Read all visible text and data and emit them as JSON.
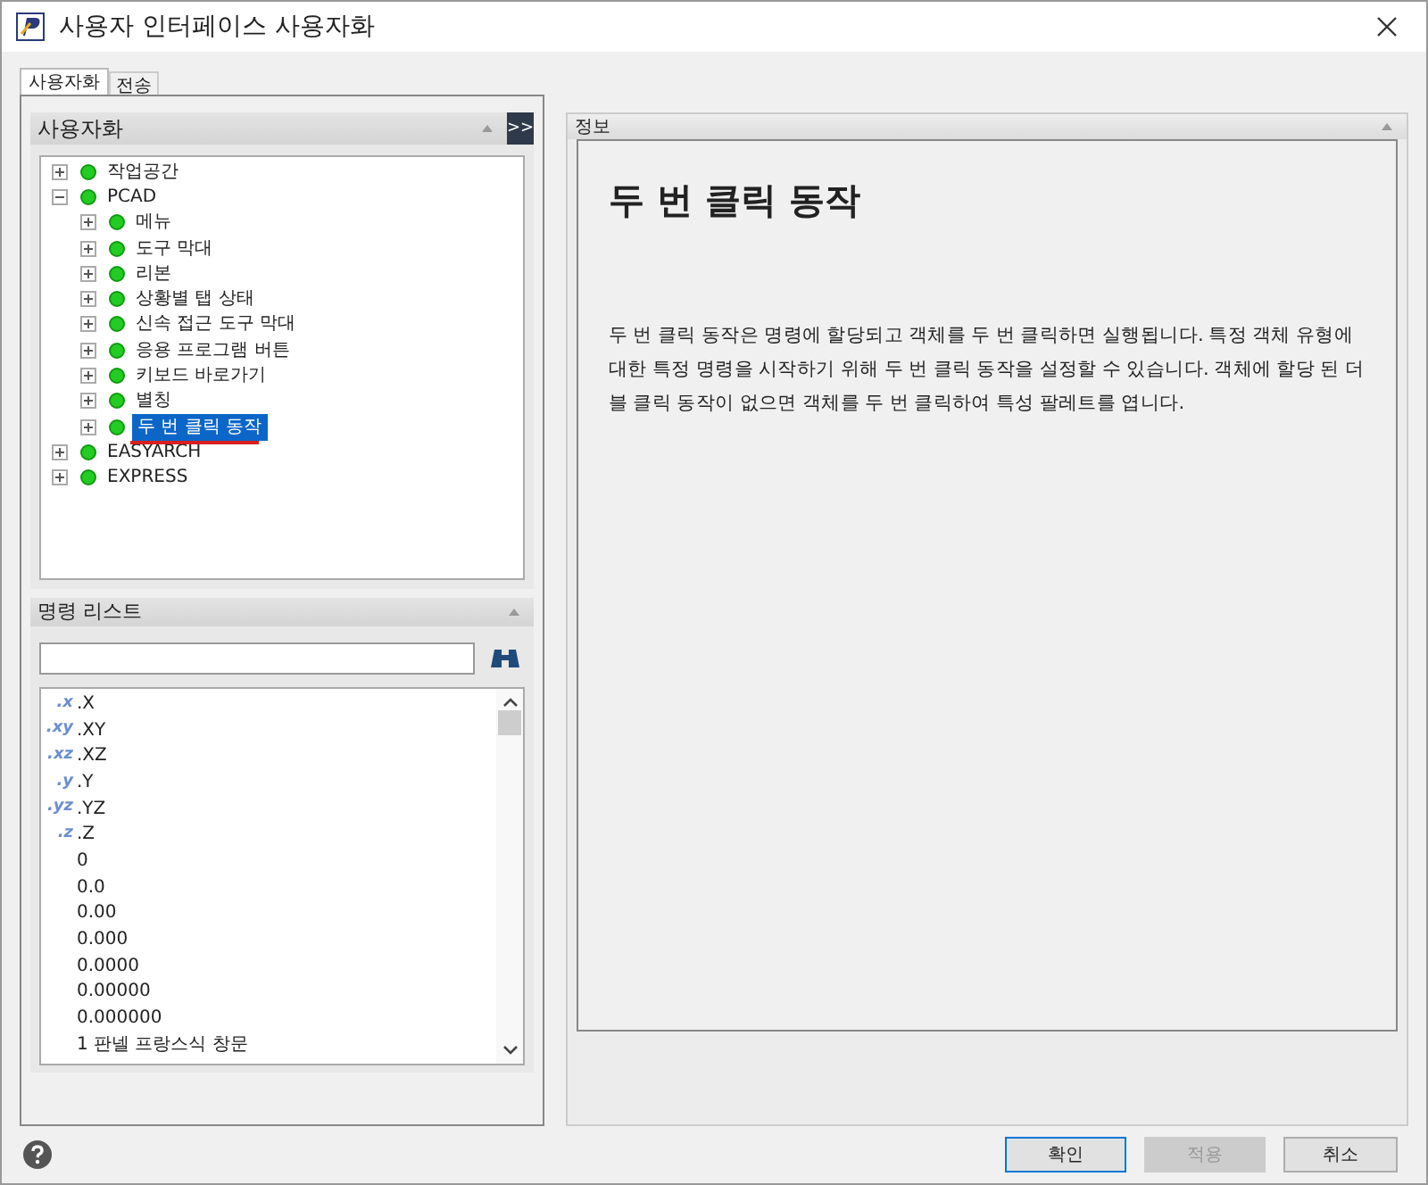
{
  "window": {
    "title": "사용자 인터페이스 사용자화"
  },
  "tabs": [
    {
      "label": "사용자화",
      "selected": true
    },
    {
      "label": "전송",
      "selected": false
    }
  ],
  "customize_panel": {
    "title": "사용자화",
    "expand_button": ">>",
    "tree": [
      {
        "label": "작업공간",
        "expanded": false,
        "selected": false
      },
      {
        "label": "PCAD",
        "expanded": true,
        "selected": false,
        "children": [
          {
            "label": "메뉴",
            "expanded": false,
            "selected": false
          },
          {
            "label": "도구 막대",
            "expanded": false,
            "selected": false
          },
          {
            "label": "리본",
            "expanded": false,
            "selected": false
          },
          {
            "label": "상황별 탭 상태",
            "expanded": false,
            "selected": false
          },
          {
            "label": "신속 접근 도구 막대",
            "expanded": false,
            "selected": false
          },
          {
            "label": "응용 프로그램 버튼",
            "expanded": false,
            "selected": false
          },
          {
            "label": "키보드 바로가기",
            "expanded": false,
            "selected": false
          },
          {
            "label": "별칭",
            "expanded": false,
            "selected": false
          },
          {
            "label": "두 번 클릭 동작",
            "expanded": false,
            "selected": true
          }
        ]
      },
      {
        "label": "EASYARCH",
        "expanded": false,
        "selected": false
      },
      {
        "label": "EXPRESS",
        "expanded": false,
        "selected": false
      }
    ]
  },
  "command_list": {
    "title": "명령 리스트",
    "items": [
      {
        "badge": ".x",
        "label": ".X"
      },
      {
        "badge": ".xy",
        "label": ".XY"
      },
      {
        "badge": ".xz",
        "label": ".XZ"
      },
      {
        "badge": ".y",
        "label": ".Y"
      },
      {
        "badge": ".yz",
        "label": ".YZ"
      },
      {
        "badge": ".z",
        "label": ".Z"
      },
      {
        "label": "0"
      },
      {
        "label": "0.0"
      },
      {
        "label": "0.00"
      },
      {
        "label": "0.000"
      },
      {
        "label": "0.0000"
      },
      {
        "label": "0.00000"
      },
      {
        "label": "0.000000"
      },
      {
        "label": "1 판넬 프랑스식 창문"
      }
    ]
  },
  "info_panel": {
    "title": "정보",
    "heading": "두 번 클릭 동작",
    "body": "두 번 클릭 동작은 명령에 할당되고 객체를 두 번 클릭하면 실행됩니다. 특정 객체 유형에 대한 특정 명령을 시작하기 위해 두 번 클릭 동작을 설정할 수 있습니다. 객체에 할당 된 더블 클릭 동작이 없으면 객체를 두 번 클릭하여 특성 팔레트를 엽니다."
  },
  "buttons": [
    {
      "label": "확인",
      "disabled": false
    },
    {
      "label": "적용",
      "disabled": true
    },
    {
      "label": "취소",
      "disabled": false
    }
  ]
}
